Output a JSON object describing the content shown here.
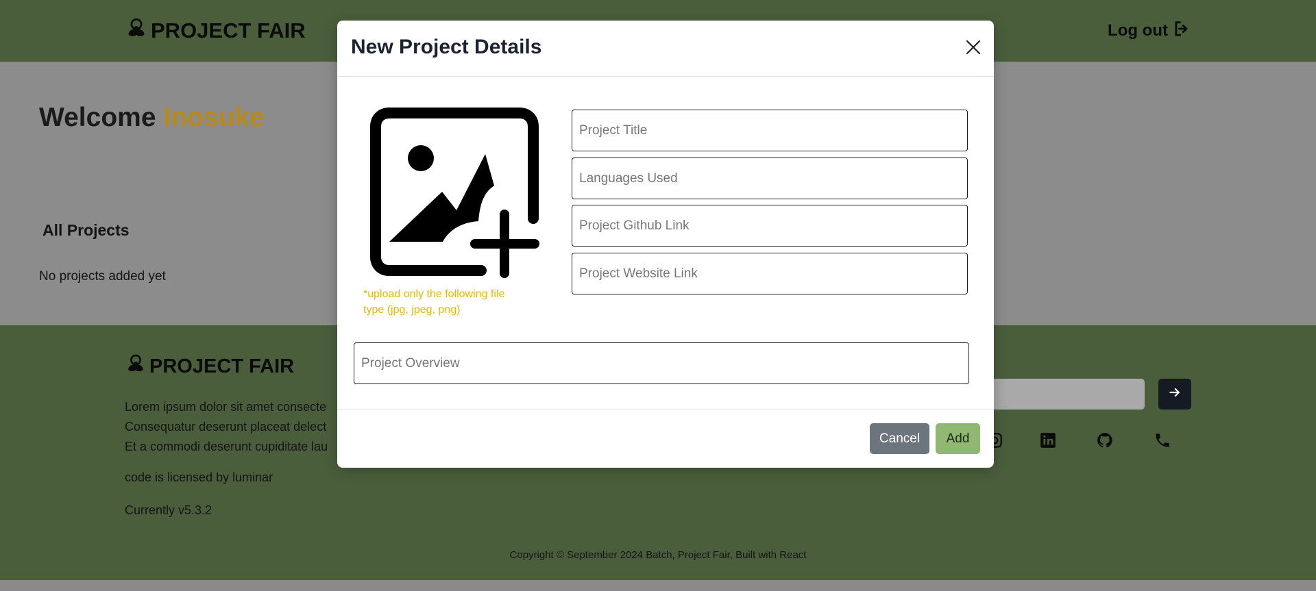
{
  "navbar": {
    "brand": "PROJECT FAIR",
    "logout_label": "Log out"
  },
  "main": {
    "welcome_prefix": "Welcome ",
    "username": "Inosuke",
    "all_projects_heading": "All Projects",
    "empty_message": "No projects added yet"
  },
  "footer": {
    "brand": "PROJECT FAIR",
    "paragraph_lines": [
      "Lorem ipsum dolor sit amet consecte",
      "Consequatur deserunt placeat delect",
      "Et a commodi deserunt cupiditate lau"
    ],
    "license": "code is licensed by luminar",
    "version": "Currently v5.3.2",
    "copyright": "Copyright © September 2024 Batch, Project Fair, Built with React"
  },
  "modal": {
    "title": "New Project Details",
    "upload_note": "*upload only the following file type (jpg, jpeg, png)",
    "fields": {
      "title_placeholder": "Project Title",
      "languages_placeholder": "Languages Used",
      "github_placeholder": "Project Github Link",
      "website_placeholder": "Project Website Link",
      "overview_placeholder": "Project Overview"
    },
    "cancel_label": "Cancel",
    "add_label": "Add"
  },
  "icons": {
    "brand": "biohazard-icon",
    "logout": "logout-icon",
    "close": "close-icon",
    "upload": "image-add-icon",
    "subscribe": "arrow-right-icon",
    "social": [
      "instagram-icon",
      "linkedin-icon",
      "github-icon",
      "phone-icon"
    ]
  },
  "colors": {
    "nav_bg": "#4a5e3c",
    "username": "#b8891c",
    "upload_note": "#e6b800",
    "add_button": "#90b870",
    "cancel_button": "#6c757d"
  }
}
